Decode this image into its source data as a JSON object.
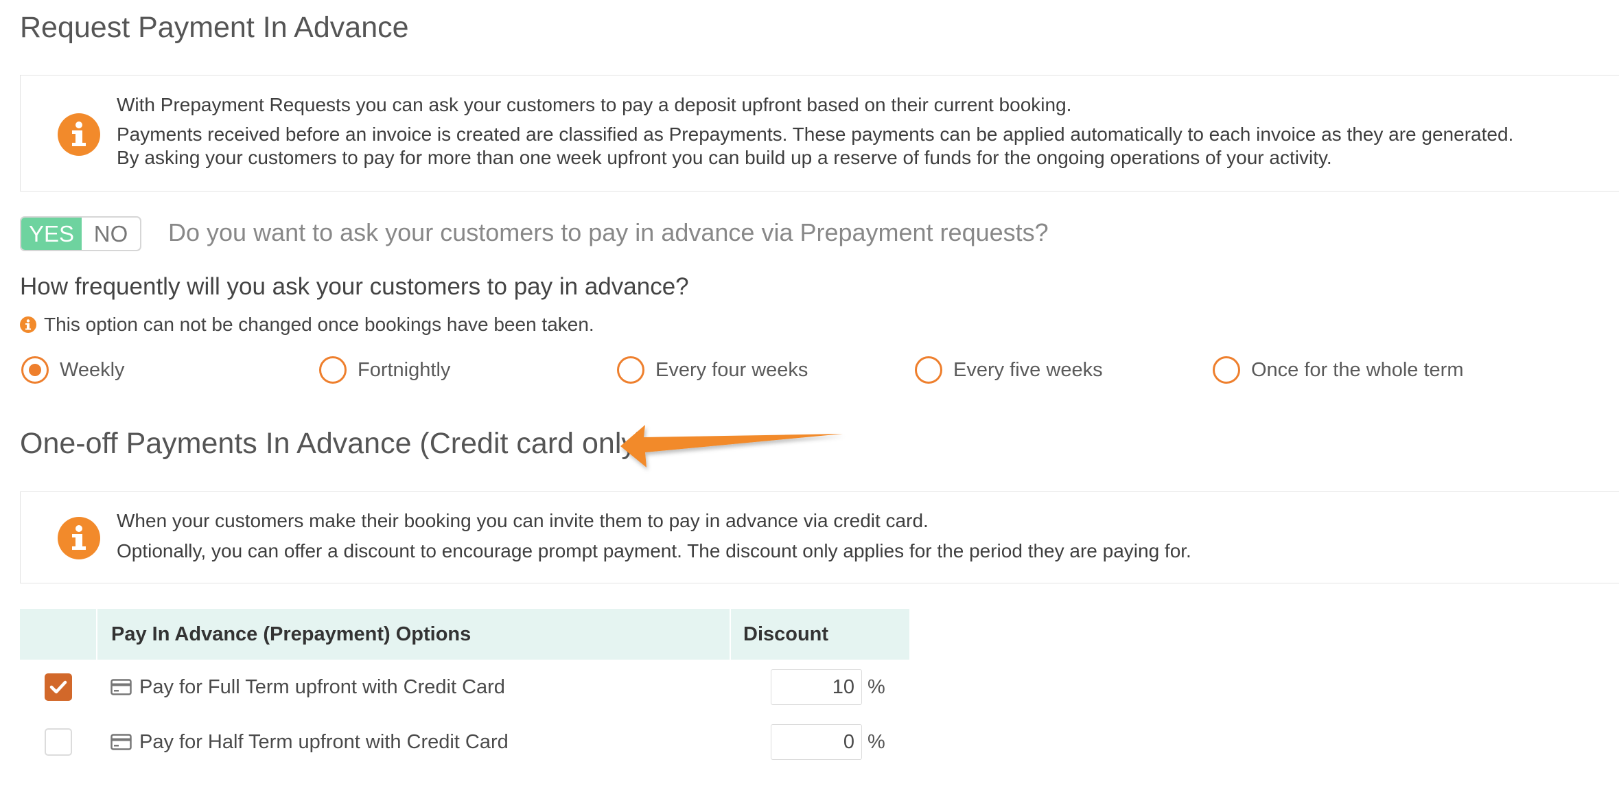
{
  "page_title": "Request Payment In Advance",
  "prepayment_info": {
    "lines": [
      "With Prepayment Requests you can ask your customers to pay a deposit upfront based on their current booking.",
      "Payments received before an invoice is created are classified as Prepayments. These payments can be applied automatically to each invoice as they are generated.",
      "By asking your customers to pay for more than one week upfront you can build up a reserve of funds for the ongoing operations of your activity."
    ]
  },
  "toggle": {
    "yes": "YES",
    "no": "NO",
    "selected": "YES"
  },
  "toggle_question": "Do you want to ask your customers to pay in advance via Prepayment requests?",
  "frequency": {
    "heading": "How frequently will you ask your customers to pay in advance?",
    "note": "This option can not be changed once bookings have been taken.",
    "options": [
      "Weekly",
      "Fortnightly",
      "Every four weeks",
      "Every five weeks",
      "Once for the whole term"
    ],
    "selected": "Weekly"
  },
  "oneoff_title": "One-off Payments In Advance (Credit card only)",
  "oneoff_info": {
    "lines": [
      "When your customers make their booking you can invite them to pay in advance via credit card.",
      "Optionally, you can offer a discount to encourage prompt payment. The discount only applies for the period they are paying for."
    ]
  },
  "options_table": {
    "headers": [
      "",
      "Pay In Advance (Prepayment) Options",
      "Discount"
    ],
    "rows": [
      {
        "checked": true,
        "label": "Pay for Full Term upfront with Credit Card",
        "discount": "10",
        "unit": "%"
      },
      {
        "checked": false,
        "label": "Pay for Half Term upfront with Credit Card",
        "discount": "0",
        "unit": "%"
      }
    ]
  },
  "colors": {
    "accent_orange": "#f28a2b",
    "toggle_green": "#6ed39f",
    "table_header_bg": "#e5f4f1",
    "checkbox_checked": "#d2682a"
  },
  "icons": [
    "info-icon",
    "credit-card-icon",
    "checkmark-icon",
    "annotation-arrow"
  ]
}
